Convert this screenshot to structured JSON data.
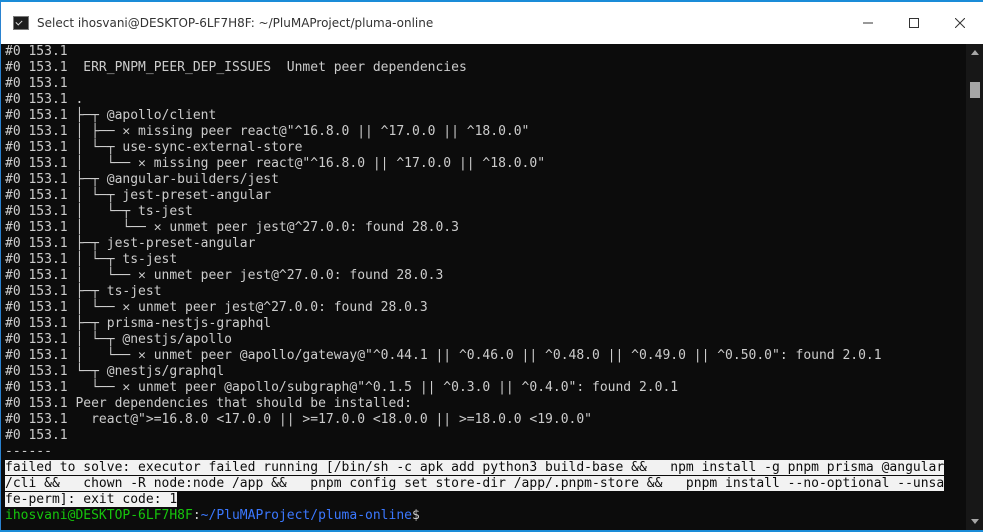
{
  "window": {
    "title": "Select ihosvani@DESKTOP-6LF7H8F: ~/PluMAProject/pluma-online"
  },
  "icons": {
    "app": "console-icon",
    "minimize": "minimize-icon",
    "maximize": "maximize-icon",
    "close": "close-icon"
  },
  "lines": [
    "#0 153.1",
    "#0 153.1  ERR_PNPM_PEER_DEP_ISSUES  Unmet peer dependencies",
    "#0 153.1",
    "#0 153.1 .",
    "#0 153.1 ├─┬ @apollo/client",
    "#0 153.1 │ ├── ✕ missing peer react@\"^16.8.0 || ^17.0.0 || ^18.0.0\"",
    "#0 153.1 │ └─┬ use-sync-external-store",
    "#0 153.1 │   └── ✕ missing peer react@\"^16.8.0 || ^17.0.0 || ^18.0.0\"",
    "#0 153.1 ├─┬ @angular-builders/jest",
    "#0 153.1 │ └─┬ jest-preset-angular",
    "#0 153.1 │   └─┬ ts-jest",
    "#0 153.1 │     └── ✕ unmet peer jest@^27.0.0: found 28.0.3",
    "#0 153.1 ├─┬ jest-preset-angular",
    "#0 153.1 │ └─┬ ts-jest",
    "#0 153.1 │   └── ✕ unmet peer jest@^27.0.0: found 28.0.3",
    "#0 153.1 ├─┬ ts-jest",
    "#0 153.1 │ └── ✕ unmet peer jest@^27.0.0: found 28.0.3",
    "#0 153.1 ├─┬ prisma-nestjs-graphql",
    "#0 153.1 │ └─┬ @nestjs/apollo",
    "#0 153.1 │   └── ✕ unmet peer @apollo/gateway@\"^0.44.1 || ^0.46.0 || ^0.48.0 || ^0.49.0 || ^0.50.0\": found 2.0.1",
    "#0 153.1 └─┬ @nestjs/graphql",
    "#0 153.1   └── ✕ unmet peer @apollo/subgraph@\"^0.1.5 || ^0.3.0 || ^0.4.0\": found 2.0.1",
    "#0 153.1 Peer dependencies that should be installed:",
    "#0 153.1   react@\">=16.8.0 <17.0.0 || >=17.0.0 <18.0.0 || >=18.0.0 <19.0.0\"",
    "#0 153.1",
    "------"
  ],
  "error_lines": [
    "failed to solve: executor failed running [/bin/sh -c apk add python3 build-base &&   npm install -g pnpm prisma @angular",
    "/cli &&   chown -R node:node /app &&   pnpm config set store-dir /app/.pnpm-store &&   pnpm install --no-optional --unsa",
    "fe-perm]: exit code: 1"
  ],
  "prompt": {
    "user_host": "ihosvani@DESKTOP-6LF7H8F",
    "colon": ":",
    "path": "~/PluMAProject/pluma-online",
    "symbol": "$"
  },
  "colors": {
    "terminal_bg": "#0c0c0c",
    "terminal_fg": "#cccccc",
    "prompt_user": "#16c60c",
    "prompt_path": "#3b78ff",
    "selection_bg": "#f2f2f2",
    "desktop_bg": "#1a8cd8"
  }
}
